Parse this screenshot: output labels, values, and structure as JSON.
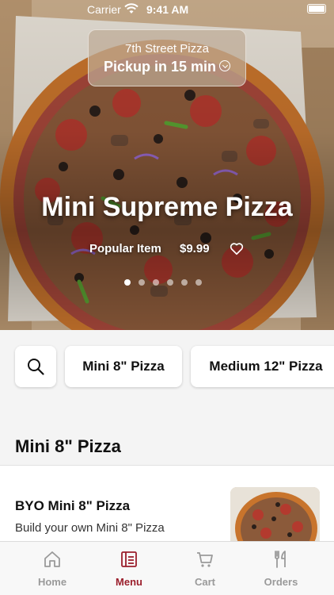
{
  "status_bar": {
    "carrier": "Carrier",
    "time": "9:41 AM"
  },
  "store": {
    "name": "7th Street Pizza",
    "pickup": "Pickup in 15 min"
  },
  "featured": {
    "title": "Mini Supreme Pizza",
    "tag": "Popular Item",
    "price": "$9.99",
    "slide_count": 6,
    "active_slide": 0
  },
  "categories": [
    {
      "label": "Mini 8\" Pizza"
    },
    {
      "label": "Medium 12\" Pizza"
    }
  ],
  "section": {
    "title": "Mini 8\" Pizza"
  },
  "items": [
    {
      "name": "BYO Mini 8\" Pizza",
      "description": "Build your own Mini 8\" Pizza"
    }
  ],
  "tabs": [
    {
      "label": "Home",
      "icon": "home-icon",
      "active": false
    },
    {
      "label": "Menu",
      "icon": "menu-icon",
      "active": true
    },
    {
      "label": "Cart",
      "icon": "cart-icon",
      "active": false
    },
    {
      "label": "Orders",
      "icon": "utensils-icon",
      "active": false
    }
  ],
  "colors": {
    "accent": "#9b1f2c",
    "tab_inactive": "#9a9a9a"
  }
}
